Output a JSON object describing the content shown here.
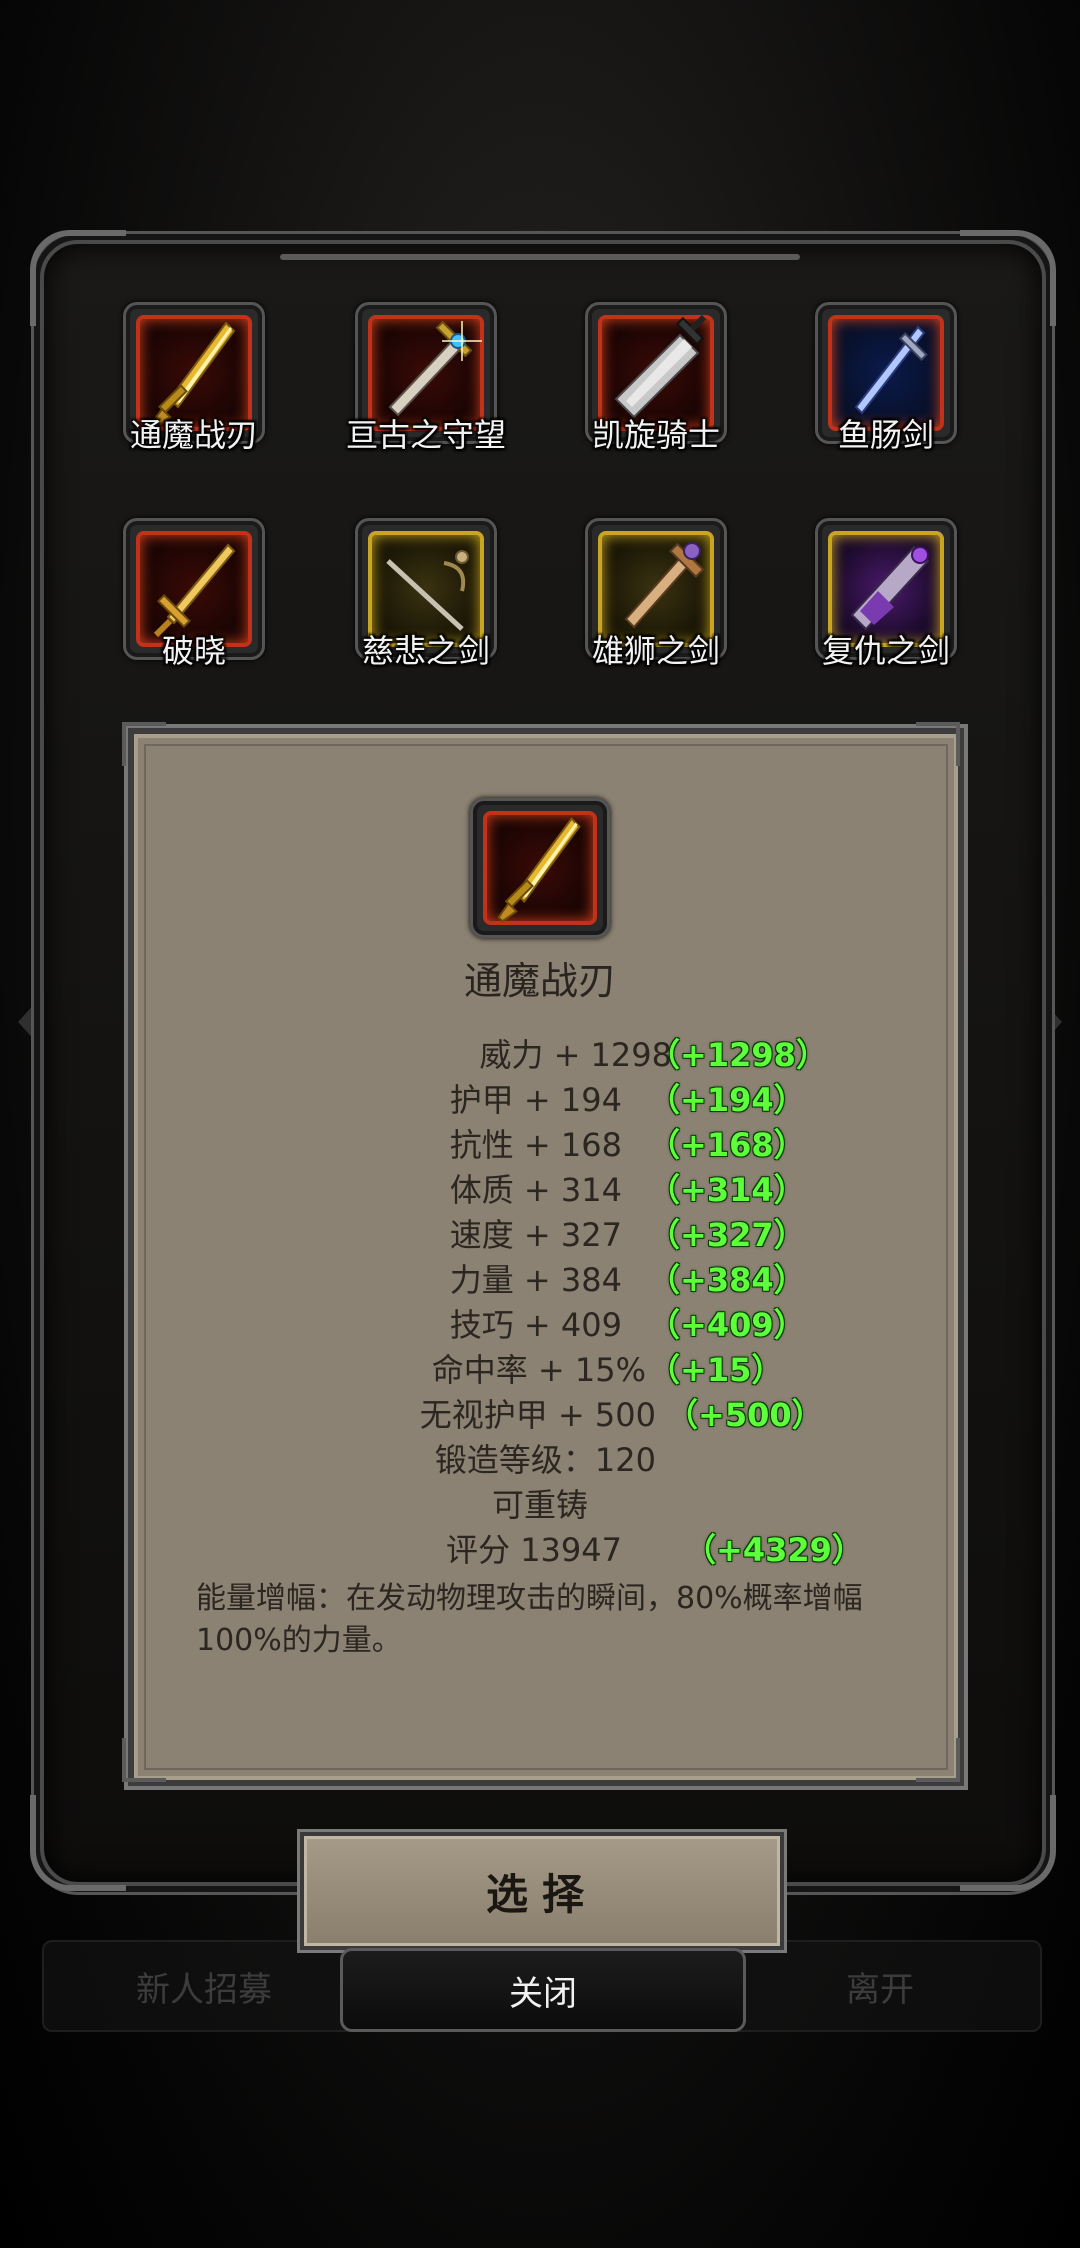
{
  "weapons": [
    {
      "name": "通魔战刃",
      "frame": "red",
      "icon": "golden-dagger-icon"
    },
    {
      "name": "亘古之守望",
      "frame": "red",
      "icon": "jeweled-sword-icon"
    },
    {
      "name": "凯旋骑士",
      "frame": "red",
      "icon": "greatsword-icon"
    },
    {
      "name": "鱼肠剑",
      "frame": "red",
      "icon": "blue-sword-icon"
    },
    {
      "name": "破晓",
      "frame": "red",
      "icon": "gold-sword-icon"
    },
    {
      "name": "慈悲之剑",
      "frame": "gold",
      "icon": "rapier-icon"
    },
    {
      "name": "雄狮之剑",
      "frame": "gold",
      "icon": "lion-sword-icon"
    },
    {
      "name": "复仇之剑",
      "frame": "gold",
      "icon": "purple-blade-icon"
    }
  ],
  "detail": {
    "name": "通魔战刃",
    "stats": [
      {
        "text": "威力 + 1298",
        "bonus": "（+1298）"
      },
      {
        "text": "护甲 + 194",
        "bonus": "（+194）"
      },
      {
        "text": "抗性 + 168",
        "bonus": "（+168）"
      },
      {
        "text": "体质 + 314",
        "bonus": "（+314）"
      },
      {
        "text": "速度 + 327",
        "bonus": "（+327）"
      },
      {
        "text": "力量 + 384",
        "bonus": "（+384）"
      },
      {
        "text": "技巧 + 409",
        "bonus": "（+409）"
      },
      {
        "text": "命中率 + 15%",
        "bonus": "（+15）"
      },
      {
        "text": "无视护甲 + 500",
        "bonus": "（+500）"
      }
    ],
    "forge_level": "锻造等级：120",
    "recastable": "可重铸",
    "score": "评分 13947",
    "score_bonus": "（+4329）",
    "description": "能量增幅：在发动物理攻击的瞬间，80%概率增幅100%的力量。"
  },
  "buttons": {
    "select": "选择",
    "close": "关闭",
    "bg_left": "新人招募",
    "bg_right": "离开"
  },
  "colors": {
    "bonus_green": "#5cff3a",
    "panel_bg": "#8c8273",
    "frame_red": "#c2321a",
    "frame_gold": "#c9a520"
  }
}
